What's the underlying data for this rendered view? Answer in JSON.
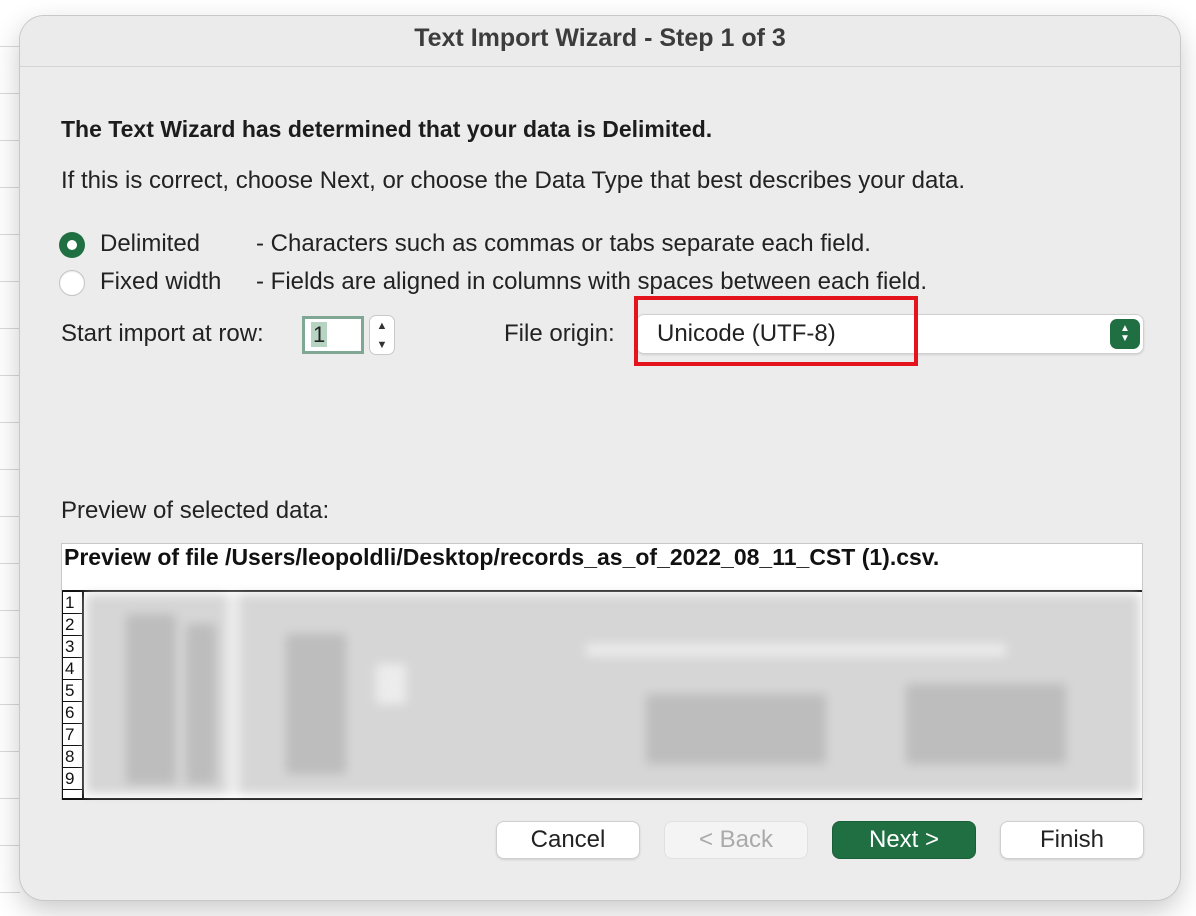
{
  "dialog": {
    "title": "Text Import Wizard - Step 1 of 3",
    "heading": "The Text Wizard has determined that your data is Delimited.",
    "subtext": "If this is correct, choose Next, or choose the Data Type that best describes your data."
  },
  "data_type": {
    "options": [
      {
        "label": "Delimited",
        "description": "- Characters such as commas or tabs separate each field.",
        "selected": true
      },
      {
        "label": "Fixed width",
        "description": "- Fields are aligned in columns with spaces between each field.",
        "selected": false
      }
    ]
  },
  "start_row": {
    "label": "Start import at row:",
    "value": "1"
  },
  "file_origin": {
    "label": "File origin:",
    "value": "Unicode (UTF-8)"
  },
  "preview": {
    "label": "Preview of selected data:",
    "title": "Preview of file /Users/leopoldli/Desktop/records_as_of_2022_08_11_CST (1).csv.",
    "row_numbers": [
      "1",
      "2",
      "3",
      "4",
      "5",
      "6",
      "7",
      "8",
      "9"
    ]
  },
  "buttons": {
    "cancel": "Cancel",
    "back": "< Back",
    "next": "Next >",
    "finish": "Finish"
  },
  "colors": {
    "accent": "#1f6f43",
    "highlight": "#e5141c"
  },
  "icons": {
    "stepper": "up-down-stepper-icon",
    "select": "chevron-up-down-icon"
  }
}
